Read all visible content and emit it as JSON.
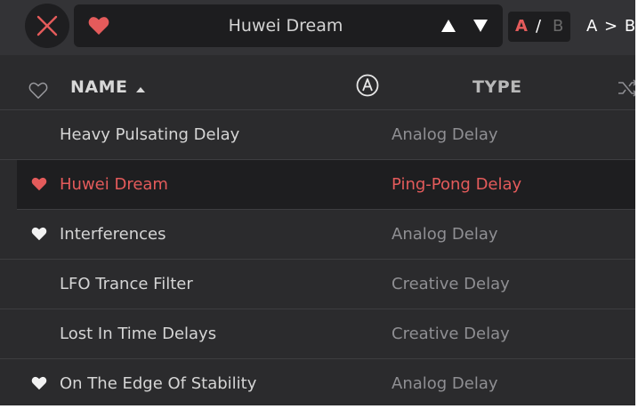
{
  "topbar": {
    "preset_name": "Huwei Dream",
    "ab": {
      "a": "A",
      "slash": "/",
      "b": "B"
    },
    "copy_label": "A > B"
  },
  "header": {
    "name_label": "NAME",
    "type_label": "TYPE"
  },
  "presets": [
    {
      "name": "Heavy Pulsating Delay",
      "type": "Analog Delay",
      "favorite": false,
      "selected": false
    },
    {
      "name": "Huwei Dream",
      "type": "Ping-Pong Delay",
      "favorite": true,
      "selected": true
    },
    {
      "name": "Interferences",
      "type": "Analog Delay",
      "favorite": true,
      "selected": false
    },
    {
      "name": "LFO Trance Filter",
      "type": "Creative Delay",
      "favorite": false,
      "selected": false
    },
    {
      "name": "Lost In Time Delays",
      "type": "Creative Delay",
      "favorite": false,
      "selected": false
    },
    {
      "name": "On The Edge Of Stability",
      "type": "Analog Delay",
      "favorite": true,
      "selected": false
    }
  ],
  "colors": {
    "accent": "#e45b5b",
    "background": "#2b2b2d",
    "text": "#d5d5d5",
    "muted": "#8f8f93"
  },
  "icons": {
    "close": "close-x-icon",
    "favorite": "heart-icon",
    "prev": "arrow-up-icon",
    "next": "arrow-down-icon",
    "sort": "sort-ascending-icon",
    "brand": "arturia-logo-icon",
    "shuffle": "shuffle-icon"
  }
}
